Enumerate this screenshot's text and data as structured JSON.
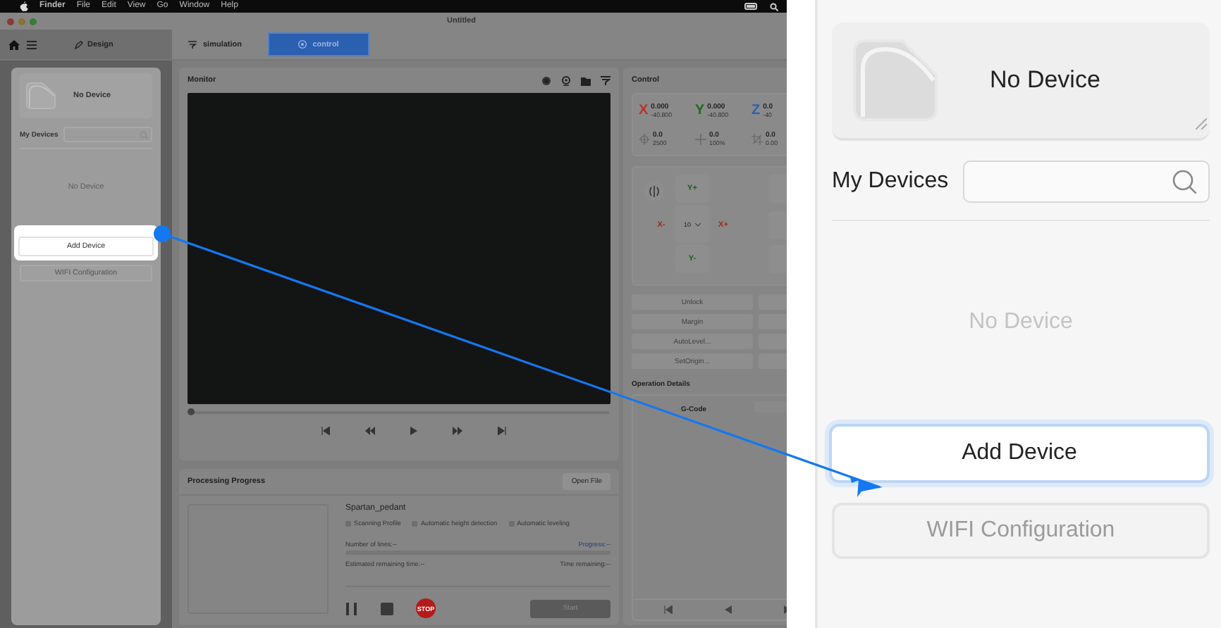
{
  "menubar": {
    "items": [
      "Finder",
      "File",
      "Edit",
      "View",
      "Go",
      "Window",
      "Help"
    ]
  },
  "window": {
    "title": "Untitled"
  },
  "toolbar": {
    "design": "Design",
    "tabs": [
      {
        "label": "simulation",
        "selected": false
      },
      {
        "label": "control",
        "selected": true
      }
    ]
  },
  "sidebar": {
    "device_name": "No Device",
    "my_devices": "My Devices",
    "empty_text": "No Device",
    "add_button": "Add Device",
    "add_highlighted": true,
    "wifi_button": "WIFI Configuration"
  },
  "monitor": {
    "title": "Monitor",
    "level": 0
  },
  "control": {
    "title": "Control",
    "axes": [
      {
        "label": "X",
        "value": "0.000",
        "reading": "-40.800",
        "color": "#b8352c"
      },
      {
        "label": "Y",
        "value": "0.000",
        "reading": "-40.800",
        "color": "#1e6a1c"
      },
      {
        "label": "Z",
        "value": "0.0",
        "reading": "-40",
        "color": "#2f5fb3"
      }
    ],
    "stats": [
      {
        "value": "0.0",
        "reading": "2500"
      },
      {
        "value": "0.0",
        "reading": "100%"
      },
      {
        "value": "0.0",
        "reading": "0.00"
      }
    ],
    "jog": {
      "y_plus": "Y+",
      "x_minus": "X-",
      "step": "10",
      "x_plus": "X+",
      "y_minus": "Y-"
    },
    "actions": [
      "Unlock",
      "Margin",
      "AutoLevel...",
      "SetOrigin..."
    ],
    "details_title": "Operation Details",
    "gcode_label": "G-Code"
  },
  "processing": {
    "title": "Processing Progress",
    "open_button": "Open File",
    "file_name": "Spartan_pedant",
    "options": [
      {
        "label": "Scanning Profile",
        "checked": false
      },
      {
        "label": "Automatic height detection",
        "checked": false
      },
      {
        "label": "Automatic leveling",
        "checked": false
      }
    ],
    "lines": "Number of lines:--",
    "progress": "Progress:--",
    "level": 0,
    "estimated": "Estimated remaining time:--",
    "time_remaining": "Time remaining:--",
    "stop_label": "STOP",
    "start_button": "Start"
  },
  "inset": {
    "device_name": "No Device",
    "my_devices": "My Devices",
    "empty_text": "No Device",
    "add_button": "Add Device",
    "add_highlighted": true,
    "wifi_button": "WIFI Configuration"
  }
}
